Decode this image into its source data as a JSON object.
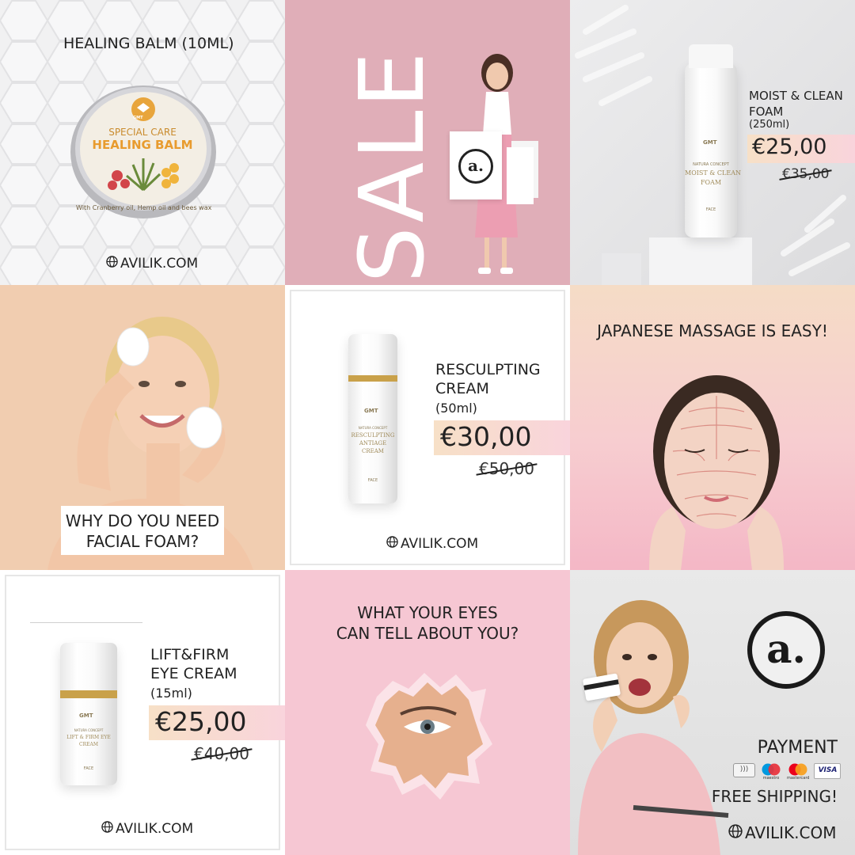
{
  "colors": {
    "sale_pink": "#e0aeb8",
    "price_gradient_start": "#f7e0c7",
    "price_gradient_end": "#f9d4dc",
    "gold": "#c9a14a"
  },
  "tile1": {
    "title": "HEALING BALM (10ML)",
    "tin_brand": "GMT",
    "tin_line1": "SPECIAL CARE",
    "tin_line2": "HEALING BALM",
    "tin_line3": "With Cranberry oil, Hemp oil and bees wax",
    "website": "AVILIK.COM"
  },
  "tile2": {
    "sale_text": "SALE",
    "bag_logo": "a."
  },
  "tile3": {
    "product_name_1": "MOIST & CLEAN",
    "product_name_2": "FOAM",
    "volume": "(250ml)",
    "price": "€25,00",
    "old_price": "€35,00",
    "bottle_brand": "GMT",
    "bottle_line1": "NATURA CONCEPT",
    "bottle_line2": "MOIST & CLEAN",
    "bottle_line3": "FOAM",
    "bottle_line4": "FACE"
  },
  "tile4": {
    "question_1": "WHY DO YOU NEED",
    "question_2": "FACIAL FOAM?"
  },
  "tile5": {
    "product_name_1": "RESCULPTING",
    "product_name_2": "CREAM",
    "volume": "(50ml)",
    "price": "€30,00",
    "old_price": "€50,00",
    "website": "AVILIK.COM",
    "bottle_brand": "GMT",
    "bottle_line1": "NATURA CONCEPT",
    "bottle_line2": "RESCULPTING",
    "bottle_line3": "ANTIAGE",
    "bottle_line4": "CREAM",
    "bottle_line5": "FACE"
  },
  "tile6": {
    "headline": "JAPANESE MASSAGE IS EASY!"
  },
  "tile7": {
    "product_name_1": "LIFT&FIRM",
    "product_name_2": "EYE CREAM",
    "volume": "(15ml)",
    "price": "€25,00",
    "old_price": "€40,00",
    "website": "AVILIK.COM",
    "bottle_brand": "GMT",
    "bottle_line1": "NATURA CONCEPT",
    "bottle_line2": "LIFT & FIRM EYE",
    "bottle_line3": "CREAM",
    "bottle_line4": "FACE"
  },
  "tile8": {
    "question_1": "WHAT YOUR EYES",
    "question_2": "CAN TELL ABOUT YOU?"
  },
  "tile9": {
    "logo": "a.",
    "payment_label": "PAYMENT",
    "card_labels": [
      "maestro",
      "mastercard",
      "VISA"
    ],
    "shipping": "FREE SHIPPING!",
    "website": "AVILIK.COM"
  }
}
